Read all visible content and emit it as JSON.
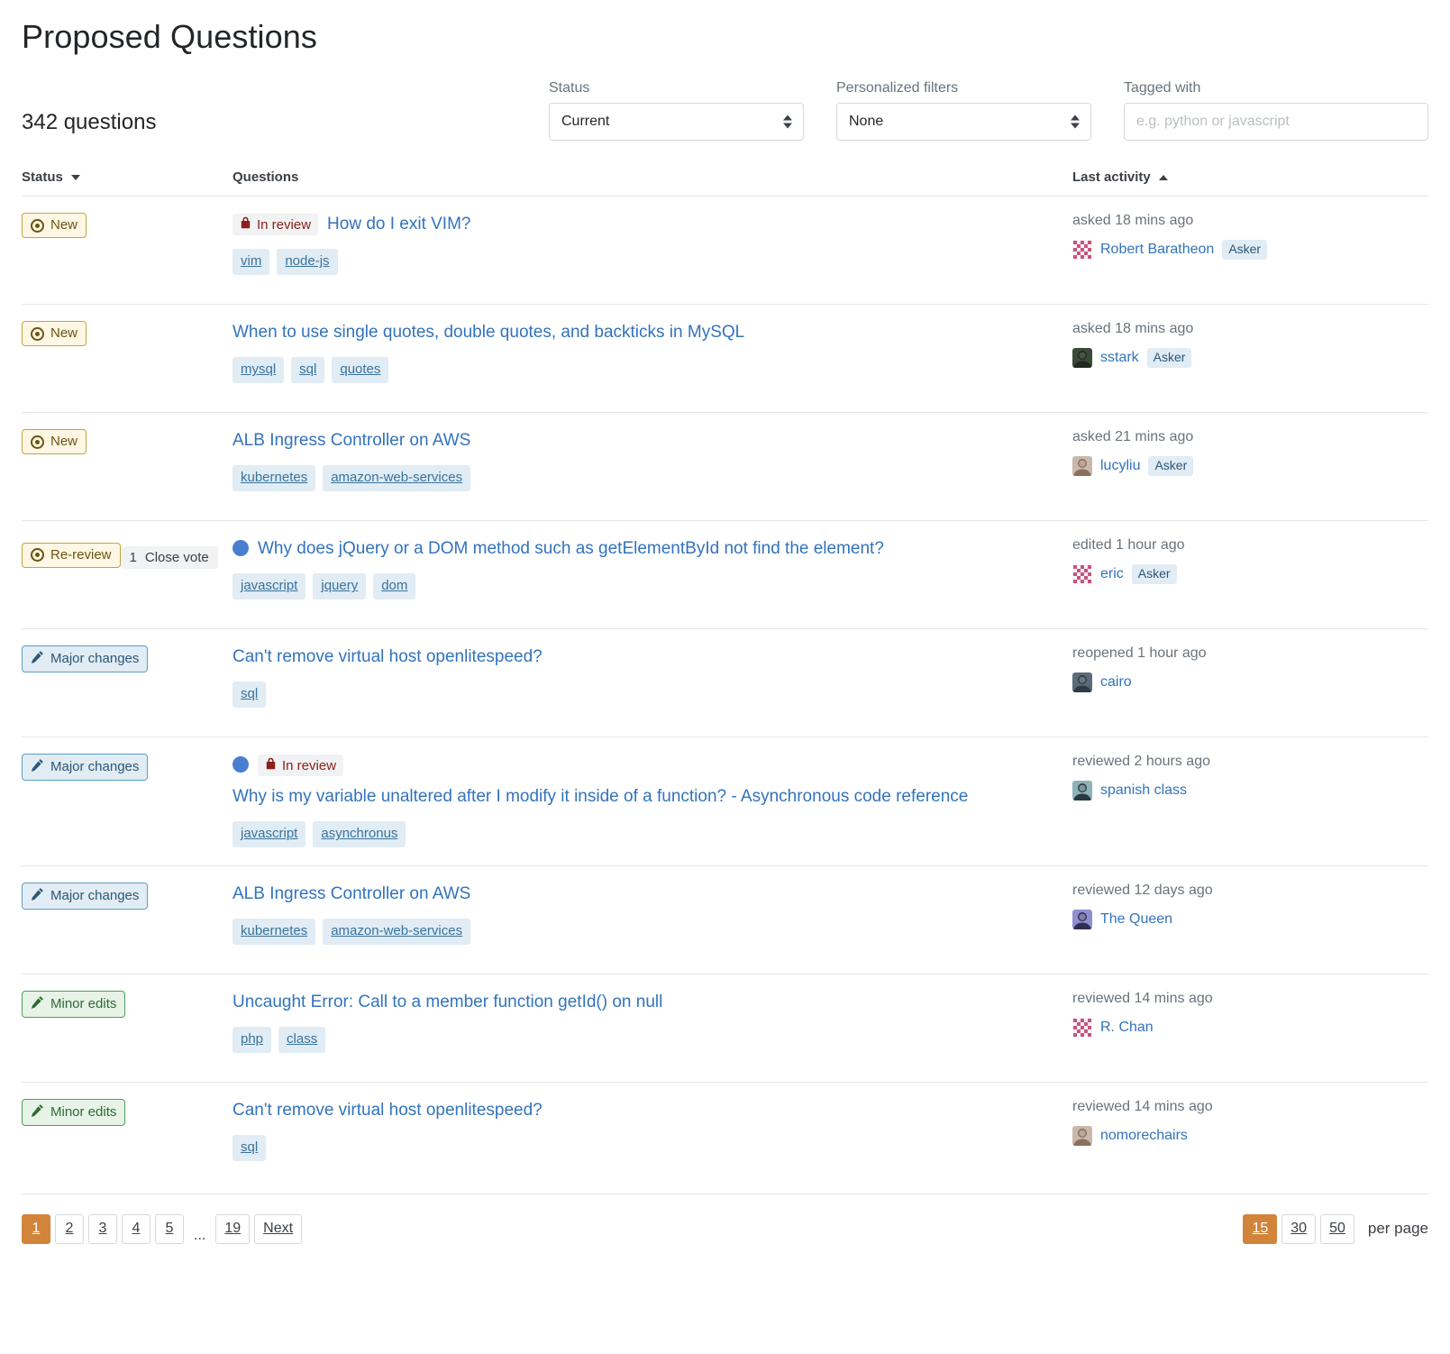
{
  "header": {
    "title": "Proposed Questions",
    "count_text": "342 questions"
  },
  "filters": {
    "status": {
      "label": "Status",
      "value": "Current"
    },
    "personalized": {
      "label": "Personalized filters",
      "value": "None"
    },
    "tagged": {
      "label": "Tagged with",
      "value": "",
      "placeholder": "e.g. python or javascript"
    }
  },
  "table": {
    "columns": {
      "status": "Status",
      "questions": "Questions",
      "activity": "Last activity"
    },
    "sort": {
      "status_dir": "desc",
      "activity_dir": "asc"
    },
    "rows": [
      {
        "status": {
          "label": "New",
          "kind": "new",
          "icon": "eye-icon"
        },
        "close_vote": null,
        "has_dot": false,
        "in_review": "In review",
        "title": "How do I exit VIM?",
        "tags": [
          "vim",
          "node-js"
        ],
        "activity": "asked 18 mins ago",
        "user": "Robert Baratheon",
        "user_badge": "Asker",
        "avatar_kind": "pattern-pink"
      },
      {
        "status": {
          "label": "New",
          "kind": "new",
          "icon": "eye-icon"
        },
        "close_vote": null,
        "has_dot": false,
        "in_review": null,
        "title": "When to use single quotes, double quotes, and backticks in MySQL",
        "tags": [
          "mysql",
          "sql",
          "quotes"
        ],
        "activity": "asked 18 mins ago",
        "user": "sstark",
        "user_badge": "Asker",
        "avatar_kind": "photo-dark"
      },
      {
        "status": {
          "label": "New",
          "kind": "new",
          "icon": "eye-icon"
        },
        "close_vote": null,
        "has_dot": false,
        "in_review": null,
        "title": "ALB Ingress Controller on AWS",
        "tags": [
          "kubernetes",
          "amazon-web-services"
        ],
        "activity": "asked 21 mins ago",
        "user": "lucyliu",
        "user_badge": "Asker",
        "avatar_kind": "photo-light"
      },
      {
        "status": {
          "label": "Re-review",
          "kind": "rereview",
          "icon": "eye-icon"
        },
        "close_vote": {
          "count": "1",
          "label": "Close vote"
        },
        "has_dot": true,
        "in_review": null,
        "title": "Why does jQuery or a DOM method such as getElementById not find the element?",
        "tags": [
          "javascript",
          "jquery",
          "dom"
        ],
        "activity": "edited 1 hour ago",
        "user": "eric",
        "user_badge": "Asker",
        "avatar_kind": "pattern-pink"
      },
      {
        "status": {
          "label": "Major changes",
          "kind": "major",
          "icon": "pencil-icon"
        },
        "close_vote": null,
        "has_dot": false,
        "in_review": null,
        "title": "Can't remove virtual host openlitespeed?",
        "tags": [
          "sql"
        ],
        "activity": "reopened 1 hour ago",
        "user": "cairo",
        "user_badge": null,
        "avatar_kind": "photo-man"
      },
      {
        "status": {
          "label": "Major changes",
          "kind": "major",
          "icon": "pencil-icon"
        },
        "close_vote": null,
        "has_dot": true,
        "in_review": "In review",
        "title": "Why is my variable unaltered after I modify it inside of a function? - Asynchronous code reference",
        "tags": [
          "javascript",
          "asynchronus"
        ],
        "activity": "reviewed 2 hours ago",
        "user": "spanish class",
        "user_badge": null,
        "avatar_kind": "photo-teal"
      },
      {
        "status": {
          "label": "Major changes",
          "kind": "major",
          "icon": "pencil-icon"
        },
        "close_vote": null,
        "has_dot": false,
        "in_review": null,
        "title": "ALB Ingress Controller on AWS",
        "tags": [
          "kubernetes",
          "amazon-web-services"
        ],
        "activity": "reviewed 12 days ago",
        "user": "The Queen",
        "user_badge": null,
        "avatar_kind": "photo-purple"
      },
      {
        "status": {
          "label": "Minor edits",
          "kind": "minor",
          "icon": "pencil-icon"
        },
        "close_vote": null,
        "has_dot": false,
        "in_review": null,
        "title": "Uncaught Error: Call to a member function getId() on null",
        "tags": [
          "php",
          "class"
        ],
        "activity": "reviewed 14 mins ago",
        "user": "R. Chan",
        "user_badge": null,
        "avatar_kind": "pattern-pink"
      },
      {
        "status": {
          "label": "Minor edits",
          "kind": "minor",
          "icon": "pencil-icon"
        },
        "close_vote": null,
        "has_dot": false,
        "in_review": null,
        "title": "Can't remove virtual host openlitespeed?",
        "tags": [
          "sql"
        ],
        "activity": "reviewed 14 mins ago",
        "user": "nomorechairs",
        "user_badge": null,
        "avatar_kind": "photo-light"
      }
    ]
  },
  "pagination": {
    "pages": [
      "1",
      "2",
      "3",
      "4",
      "5"
    ],
    "ellipsis": "...",
    "last_page": "19",
    "next_label": "Next",
    "current_page": "1",
    "per_page_options": [
      "15",
      "30",
      "50"
    ],
    "per_page_current": "15",
    "per_page_label": "per page"
  },
  "colors": {
    "accent_orange": "#d1843a",
    "link_blue": "#3273bd",
    "badge_new_border": "#c2a542",
    "badge_major_border": "#5a9ec9",
    "badge_minor_border": "#4f9e56",
    "in_review_red": "#8c2019"
  }
}
